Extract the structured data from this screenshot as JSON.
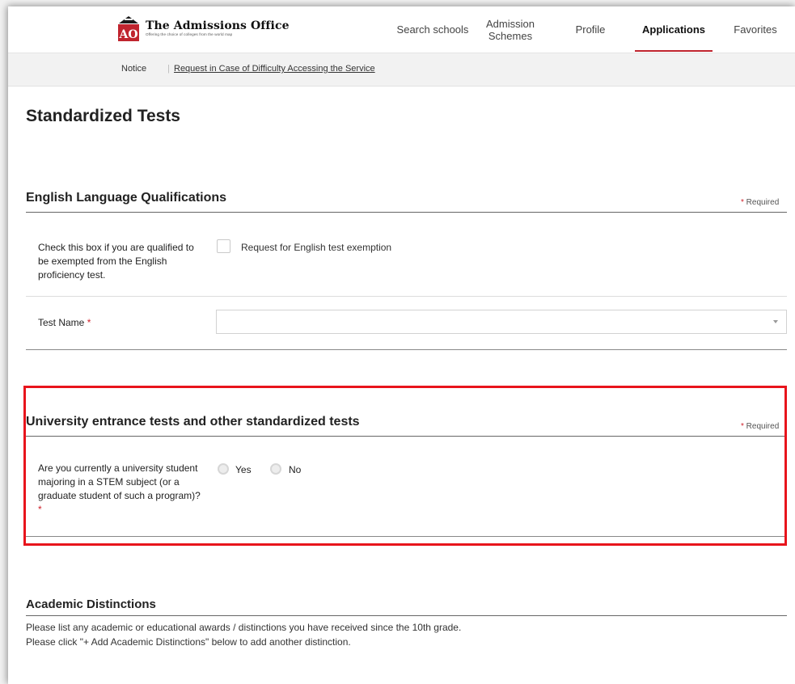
{
  "header": {
    "logo": {
      "monogram": "AO",
      "title": "The Admissions Office",
      "tagline": "Offering the choice of colleges from the world map"
    },
    "nav": [
      {
        "label": "Search schools",
        "active": false
      },
      {
        "label": "Admission Schemes",
        "active": false
      },
      {
        "label": "Profile",
        "active": false
      },
      {
        "label": "Applications",
        "active": true
      },
      {
        "label": "Favorites",
        "active": false
      }
    ]
  },
  "notice_bar": {
    "label": "Notice",
    "separator": "|",
    "link": "Request in Case of Difficulty Accessing the Service"
  },
  "page_title": "Standardized Tests",
  "english": {
    "title": "English Language Qualifications",
    "required": "Required",
    "exemption_label": "Check this box if you are qualified to be exempted from the English proficiency test.",
    "exemption_checkbox": "Request for English test exemption",
    "exemption_checked": false,
    "test_name_label": "Test Name",
    "test_name_value": ""
  },
  "entrance": {
    "title": "University entrance tests and other standardized tests",
    "required": "Required",
    "stem_question": "Are you currently a university student majoring in a STEM subject (or a graduate student of such a program)?",
    "options": [
      "Yes",
      "No"
    ],
    "selected": null
  },
  "academic": {
    "title": "Academic Distinctions",
    "line1": "Please list any academic or educational awards / distinctions you have received since the 10th grade.",
    "line2": "Please click \"+ Add Academic Distinctions\" below to add another distinction."
  },
  "colors": {
    "accent_red": "#c0242e",
    "required_star": "#d0212b",
    "highlight_box": "#e8141c",
    "notice_bg": "#f2f2f2"
  },
  "icons": {
    "logo": "building-icon",
    "select_caret": "chevron-down-icon"
  }
}
